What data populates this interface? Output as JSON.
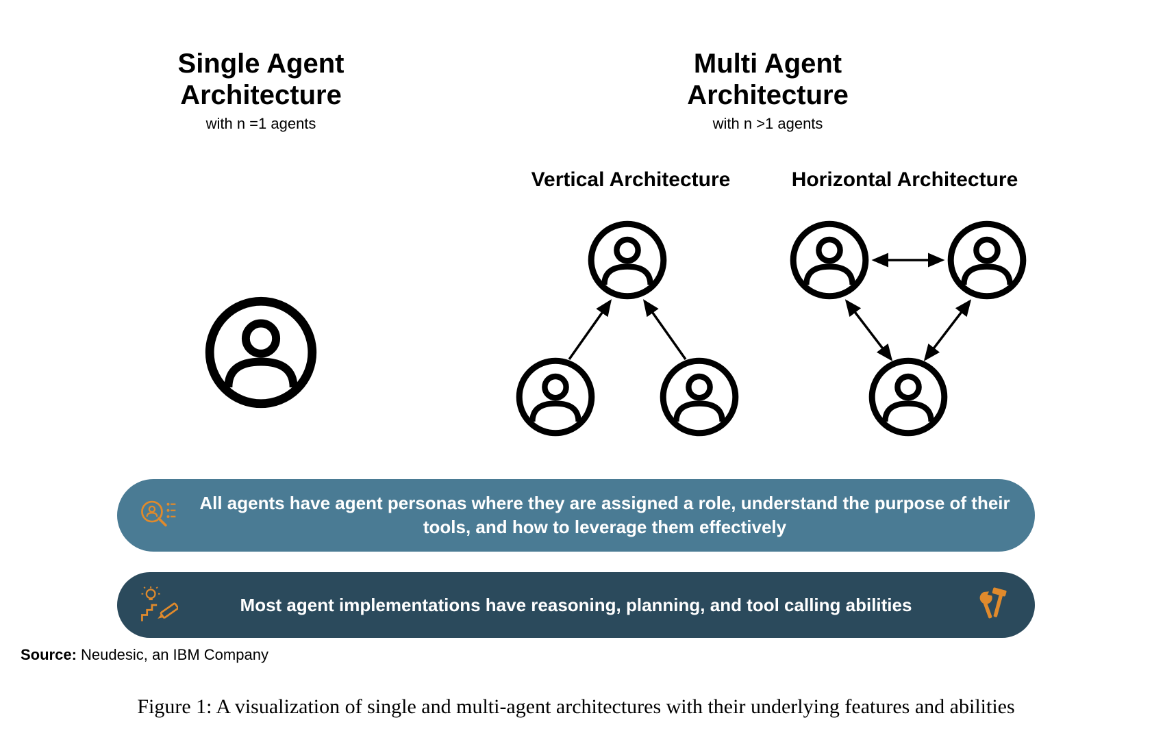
{
  "single": {
    "title_line1": "Single Agent",
    "title_line2": "Architecture",
    "subtitle": "with n =1 agents"
  },
  "multi": {
    "title_line1": "Multi Agent",
    "title_line2": "Architecture",
    "subtitle": "with n >1 agents",
    "vertical_label": "Vertical Architecture",
    "horizontal_label": "Horizontal Architecture"
  },
  "banner1_text": "All agents have agent personas where they are assigned a role, understand the purpose of their tools, and how to leverage them effectively",
  "banner2_text": "Most agent implementations have reasoning, planning, and tool calling abilities",
  "source_label": "Source:",
  "source_value": " Neudesic, an IBM Company",
  "caption": "Figure 1: A visualization of single and multi-agent architectures with their underlying features and abilities",
  "colors": {
    "banner1": "#4A7B94",
    "banner2": "#2B4A5C",
    "accent": "#E08A2C"
  }
}
